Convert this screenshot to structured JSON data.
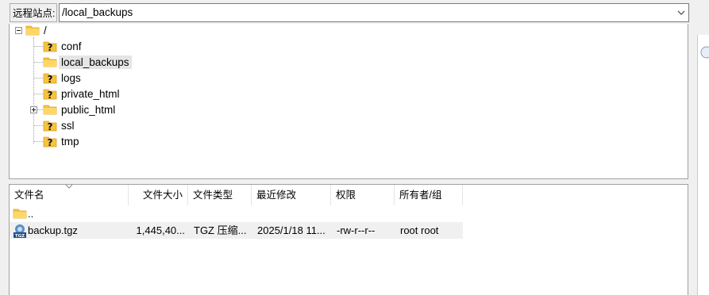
{
  "address_bar": {
    "label": "远程站点:",
    "path": "/local_backups"
  },
  "tree": {
    "root": "/",
    "items": [
      {
        "label": "conf",
        "icon": "question-folder-icon",
        "expandable": false
      },
      {
        "label": "local_backups",
        "icon": "folder-icon",
        "expandable": false,
        "selected": true
      },
      {
        "label": "logs",
        "icon": "question-folder-icon",
        "expandable": false
      },
      {
        "label": "private_html",
        "icon": "question-folder-icon",
        "expandable": false
      },
      {
        "label": "public_html",
        "icon": "folder-icon",
        "expandable": true
      },
      {
        "label": "ssl",
        "icon": "question-folder-icon",
        "expandable": false
      },
      {
        "label": "tmp",
        "icon": "question-folder-icon",
        "expandable": false
      }
    ]
  },
  "list": {
    "columns": {
      "name": "文件名",
      "size": "文件大小",
      "type": "文件类型",
      "modified": "最近修改",
      "perms": "权限",
      "owner": "所有者/组"
    },
    "rows": [
      {
        "name": "..",
        "icon": "parent-folder-icon",
        "size": "",
        "type": "",
        "modified": "",
        "perms": "",
        "owner": ""
      },
      {
        "name": "backup.tgz",
        "icon": "tgz-archive-icon",
        "size": "1,445,40...",
        "type": "TGZ 压缩...",
        "modified": "2025/1/18 11...",
        "perms": "-rw-r--r--",
        "owner": "root root",
        "selected": true
      }
    ]
  },
  "colors": {
    "folder": "#f5c342",
    "question": "#f1c232",
    "selection": "#e5e5e5",
    "border": "#a0a0a0"
  }
}
